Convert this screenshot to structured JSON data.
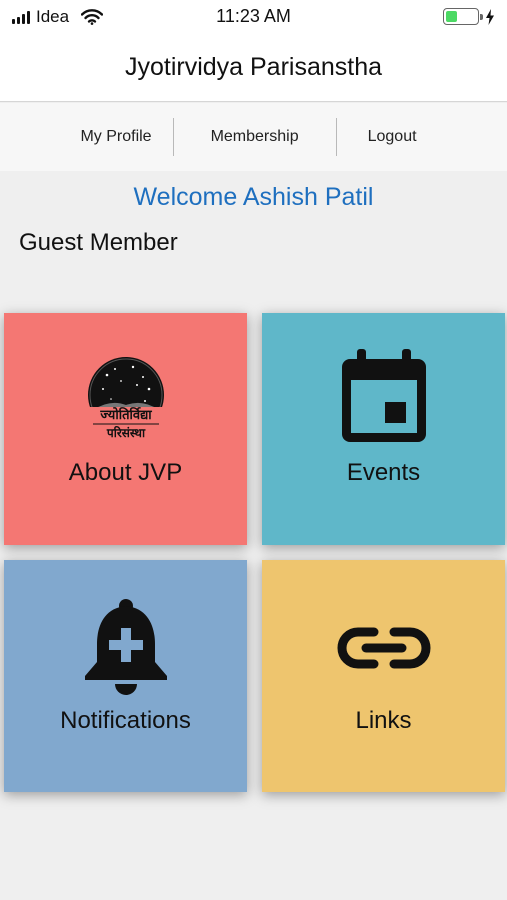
{
  "status_bar": {
    "carrier": "Idea",
    "time": "11:23 AM",
    "battery_level": 0.3
  },
  "header": {
    "title": "Jyotirvidya Parisanstha"
  },
  "nav": {
    "items": [
      {
        "label": "My Profile"
      },
      {
        "label": "Membership"
      },
      {
        "label": "Logout"
      }
    ]
  },
  "welcome": {
    "greeting": "Welcome Ashish Patil",
    "member_type": "Guest Member"
  },
  "tiles": [
    {
      "label": "About JVP",
      "icon": "jvp-logo-icon",
      "color": "#f47773"
    },
    {
      "label": "Events",
      "icon": "calendar-icon",
      "color": "#5fb7c9"
    },
    {
      "label": "Notifications",
      "icon": "bell-plus-icon",
      "color": "#81a8ce"
    },
    {
      "label": "Links",
      "icon": "link-icon",
      "color": "#eec56e"
    }
  ],
  "logo": {
    "line1": "ज्योतिर्विद्या",
    "line2": "परिसंस्था"
  }
}
